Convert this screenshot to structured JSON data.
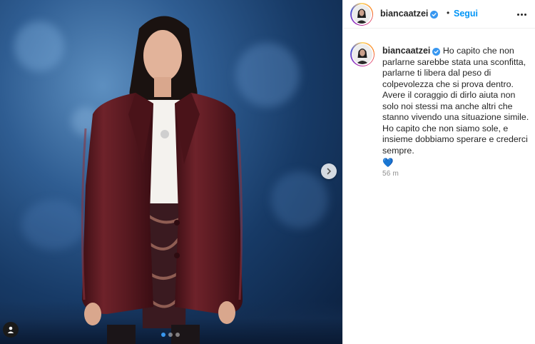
{
  "post": {
    "username": "biancaatzei",
    "follow_label": "Segui",
    "separator": "•",
    "verified": true,
    "caption": "Ho capito che non parlarne sarebbe stata una sconfitta, parlarne ti libera dal peso di colpevolezza che si prova dentro.\nAvere il coraggio di dirlo aiuta non solo noi stessi ma anche altri che stanno vivendo una situazione simile.\nHo capito che non siamo sole, e insieme dobbiamo sperare e crederci sempre.",
    "emoji": "💙",
    "timestamp": "56 m"
  },
  "carousel": {
    "slide_count": 3,
    "active_index": 0
  },
  "icons": {
    "verified": "verified-badge-icon",
    "more": "more-options-icon",
    "next": "chevron-right-icon",
    "tags": "user-tag-icon"
  },
  "colors": {
    "accent": "#0095f6",
    "verified": "#3897f0",
    "text": "#262626",
    "muted": "#8e8e8e",
    "jacket": "#5e1b22"
  }
}
